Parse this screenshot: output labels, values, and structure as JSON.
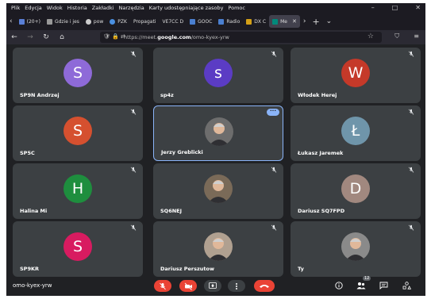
{
  "browser": {
    "menu": [
      "Plik",
      "Edycja",
      "Widok",
      "Historia",
      "Zakładki",
      "Narzędzia",
      "Karty udostępniające zasoby",
      "Pomoc"
    ],
    "tabs": [
      {
        "label": "(20+)",
        "color": "#5a7fd6"
      },
      {
        "label": "Gdzie i jes",
        "color": "#999999"
      },
      {
        "label": "pow",
        "color": "#cccccc"
      },
      {
        "label": "PZK",
        "color": "#4a8fe0"
      },
      {
        "label": "Propagati",
        "color": "#888888"
      },
      {
        "label": "VE7CC D",
        "color": "#777777"
      },
      {
        "label": "GOOC",
        "color": "#4a7fd0"
      },
      {
        "label": "Radio",
        "color": "#4a7fd0"
      },
      {
        "label": "DX C",
        "color": "#d4a017"
      },
      {
        "label": "Me",
        "color": "#00897b"
      }
    ],
    "url_prefix": "https://meet.",
    "url_domain": "google.com",
    "url_path": "/omo-kyex-yrw"
  },
  "meeting": {
    "code": "omo-kyex-yrw",
    "participant_count": "12",
    "participants": [
      {
        "name": "SP9N Andrzej",
        "initial": "S",
        "color": "#8e6ad8",
        "photo": false
      },
      {
        "name": "sp4z",
        "initial": "s",
        "color": "#5b3cc4",
        "photo": false
      },
      {
        "name": "Włodek Herej",
        "initial": "W",
        "color": "#c53929",
        "photo": false
      },
      {
        "name": "SP5C",
        "initial": "S",
        "color": "#d5502f",
        "photo": false
      },
      {
        "name": "Jerzy Greblicki",
        "initial": "",
        "color": "#6d6d6d",
        "photo": true
      },
      {
        "name": "Łukasz Jaremek",
        "initial": "Ł",
        "color": "#6f95aa",
        "photo": false
      },
      {
        "name": "Halina Mi",
        "initial": "H",
        "color": "#1e8e3e",
        "photo": false
      },
      {
        "name": "SQ6NEJ",
        "initial": "",
        "color": "#7a6a58",
        "photo": true
      },
      {
        "name": "Dariusz SQ7FPD",
        "initial": "D",
        "color": "#a1887f",
        "photo": false
      },
      {
        "name": "SP9KR",
        "initial": "S",
        "color": "#d81b60",
        "photo": false
      },
      {
        "name": "Dariusz Perszutow",
        "initial": "",
        "color": "#b0a090",
        "photo": true
      },
      {
        "name": "Ty",
        "initial": "",
        "color": "#8a8a8a",
        "photo": true
      }
    ]
  }
}
